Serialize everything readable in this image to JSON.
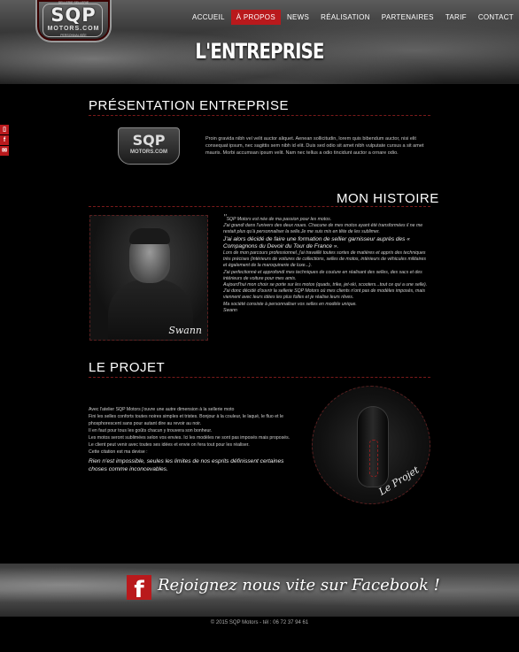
{
  "logo": {
    "main": "SQP",
    "sub": "MOTORS.COM",
    "tag_top": "SELLERIE SELLERIE",
    "tag_bottom": "PERSONNALISÉE"
  },
  "nav": {
    "items": [
      "ACCUEIL",
      "À PROPOS",
      "NEWS",
      "RÉALISATION",
      "PARTENAIRES",
      "TARIF",
      "CONTACT"
    ],
    "active": "À PROPOS"
  },
  "hero": {
    "title": "L'ENTREPRISE"
  },
  "side_social": [
    "book-icon",
    "facebook-icon",
    "mail-icon"
  ],
  "presentation": {
    "heading": "PRÉSENTATION ENTREPRISE",
    "text": "Proin gravida nibh vel velit auctor aliquet. Aenean sollicitudin, lorem quis bibendum auctor, nisi elit consequat ipsum, nec sagittis sem nibh id elit. Duis sed odio sit amet nibh vulputate cursus a sit amet mauris. Morbi accumsan ipsum velit. Nam nec tellus a odio tincidunt auctor a ornare odio."
  },
  "histoire": {
    "heading": "MON HISTOIRE",
    "photo_caption": "Swann",
    "lines": [
      "SQP Motors est née de ma passion pour les motos.",
      "J'ai grandi dans l'univers des deux roues. Chacune de mes motos ayant été transformées il ne me restait plus qu'à personnaliser la selle.Je me suis mis en tête de les sublimer.",
      "J'ai alors décidé de faire une formation de sellier garnisseur auprès des « Compagnons du Devoir du Tour de France ».",
      "Lors de mon parcours professionnel, j'ai travaillé toutes sortes de matières et appris des techniques très précises (intérieurs de voitures de collections, selles de motos, intérieurs de véhicules militaires et également de la maroquinerie de luxe...).",
      "J'ai perfectionné et approfondi mes techniques de couture en réalisant des selles, des sacs et des intérieurs de voiture pour mes amis.",
      "Aujourd'hui mon choix se porte sur les motos (quads, trike, jet-ski, scooters...tout ce qui a une selle).",
      "J'ai donc décidé d'ouvrir la sellerie SQP Motors où mes clients n'ont pas de modèles imposés, mais viennent avec leurs idées les plus folles et je réalise leurs rêves.",
      "Ma société consiste à personnaliser vos selles en modèle unique.",
      "Swann"
    ]
  },
  "projet": {
    "heading": "LE PROJET",
    "lines": [
      "Avec l'atelier SQP Motors j'ouvre une autre dimension à la sellerie moto",
      "Fini les selles conforts toutes noires simples et tristes. Bonjour à la couleur, le laqué, le fluo et le phosphorescent sans pour autant dire au revoir au noir.",
      "Il en faut pour tous les goûts chacun y trouvera son bonheur.",
      "Les motos seront sublimées selon vos envies. Ici les modèles ne sont pas imposés mais proposés.",
      "Le client peut venir avec toutes ses idées et envie on fera tout pour les réaliser.",
      "Cette citation est ma devise :"
    ],
    "quote": "Rien n'est impossible, seules les limites de nos esprits définissent certaines choses comme inconcevables.",
    "image_caption": "Le Projet"
  },
  "footer": {
    "facebook_cta": "Rejoignez nous vite sur Facebook !",
    "copyright": "© 2015 SQP Motors - tél : 06 72 37 94 61"
  },
  "colors": {
    "accent": "#b9191c",
    "background": "#000000"
  }
}
